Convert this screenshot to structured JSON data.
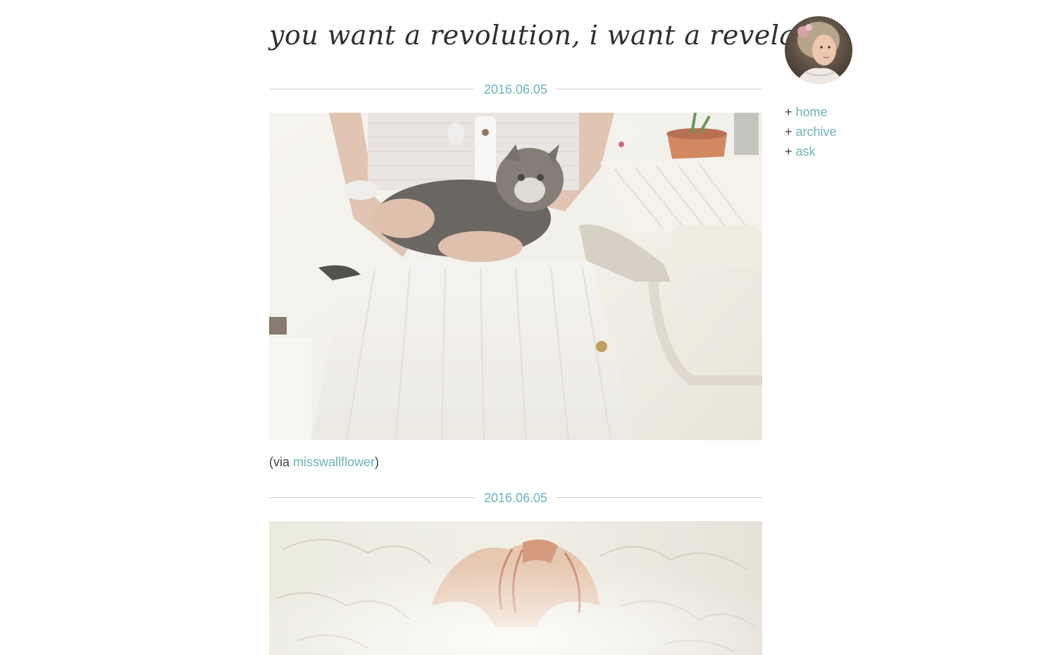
{
  "blog": {
    "title": "you want a revolution, i want a revelation"
  },
  "nav": {
    "items": [
      {
        "prefix": "+",
        "label": "home"
      },
      {
        "prefix": "+",
        "label": "archive"
      },
      {
        "prefix": "+",
        "label": "ask"
      }
    ]
  },
  "posts": [
    {
      "date": "2016.06.05",
      "via_prefix": "(via",
      "via_user": "misswallflower",
      "via_suffix": ")"
    },
    {
      "date": "2016.06.05"
    }
  ],
  "colors": {
    "accent": "#6fb3b8",
    "text": "#444444",
    "rule": "#cfcfcf"
  }
}
